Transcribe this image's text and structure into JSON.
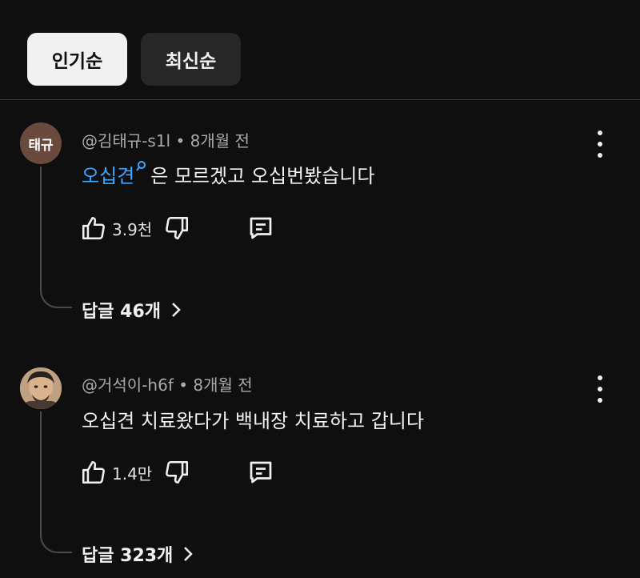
{
  "sort_chips": [
    {
      "label": "인기순",
      "active": true
    },
    {
      "label": "최신순",
      "active": false
    }
  ],
  "comments": [
    {
      "avatar_text": "태규",
      "handle": "@김태규-s1l",
      "time": "8개월 전",
      "text_link": "오십견",
      "text": "은 모르겠고 오십번봤습니다",
      "likes": "3.9천",
      "replies_label": "답글 46개"
    },
    {
      "avatar_text": "",
      "handle": "@거석이-h6f",
      "time": "8개월 전",
      "text_link": "",
      "text": "오십견 치료왔다가 백내장 치료하고 갑니다",
      "likes": "1.4만",
      "replies_label": "답글 323개"
    }
  ],
  "separator": "•",
  "icons": {
    "like": "thumb-up-icon",
    "dislike": "thumb-down-icon",
    "reply": "comment-icon",
    "menu": "more-vertical-icon",
    "chevron": "chevron-right-icon",
    "search": "search-icon"
  },
  "colors": {
    "background": "#0f0f0f",
    "link": "#3ea6ff",
    "chip_active": "#f1f1f1",
    "chip_inactive": "#272727"
  }
}
